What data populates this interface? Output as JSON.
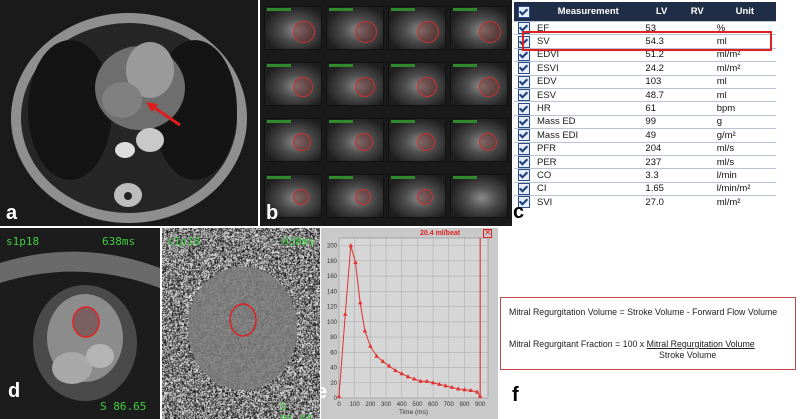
{
  "panel_labels": {
    "a": "a",
    "b": "b",
    "c": "c",
    "d": "d",
    "e": "e",
    "f": "f"
  },
  "table": {
    "headers": [
      "Measurement",
      "LV",
      "RV",
      "Unit"
    ],
    "highlight_row": "SV",
    "rows": [
      {
        "name": "EF",
        "lv": "53",
        "rv": "",
        "unit": "%"
      },
      {
        "name": "SV",
        "lv": "54.3",
        "rv": "",
        "unit": "ml"
      },
      {
        "name": "EDVI",
        "lv": "51.2",
        "rv": "",
        "unit": "ml/m²"
      },
      {
        "name": "ESVI",
        "lv": "24.2",
        "rv": "",
        "unit": "ml/m²"
      },
      {
        "name": "EDV",
        "lv": "103",
        "rv": "",
        "unit": "ml"
      },
      {
        "name": "ESV",
        "lv": "48.7",
        "rv": "",
        "unit": "ml"
      },
      {
        "name": "HR",
        "lv": "61",
        "rv": "",
        "unit": "bpm"
      },
      {
        "name": "Mass ED",
        "lv": "99",
        "rv": "",
        "unit": "g"
      },
      {
        "name": "Mass EDI",
        "lv": "49",
        "rv": "",
        "unit": "g/m²"
      },
      {
        "name": "PFR",
        "lv": "204",
        "rv": "",
        "unit": "ml/s"
      },
      {
        "name": "PER",
        "lv": "237",
        "rv": "",
        "unit": "ml/s"
      },
      {
        "name": "CO",
        "lv": "3.3",
        "rv": "",
        "unit": "l/min"
      },
      {
        "name": "CI",
        "lv": "1.65",
        "rv": "",
        "unit": "l/min/m²"
      },
      {
        "name": "SVI",
        "lv": "27.0",
        "rv": "",
        "unit": "ml/m²"
      }
    ]
  },
  "overlay_d": {
    "slice": "s1p18",
    "time": "638ms",
    "bottom": "S 86.65"
  },
  "overlay_e_map": {
    "slice": "s1p18",
    "time": "638ms",
    "bottom": "S 86.65"
  },
  "flow_chart_header": "20.4 ml/beat",
  "formula": {
    "line1": "Mitral Regurgitation Volume = Stroke Volume - Forward Flow Volume",
    "line2_prefix": "Mitral Regurgitant Fraction = 100 x ",
    "line2_numerator": "Mitral Regurgitation Volume",
    "line3_denominator": "Stroke Volume"
  },
  "chart_data": {
    "type": "line",
    "xlabel": "Time (ms)",
    "ylabel": "",
    "xlim": [
      0,
      950
    ],
    "ylim": [
      0,
      210
    ],
    "x_ticks": [
      0,
      100,
      200,
      300,
      400,
      500,
      600,
      700,
      800,
      900
    ],
    "y_ticks": [
      0,
      20,
      40,
      60,
      80,
      100,
      120,
      140,
      160,
      180,
      200
    ],
    "grid": true,
    "series": [
      {
        "color": "#e03030",
        "x": [
          0,
          40,
          75,
          105,
          135,
          165,
          200,
          240,
          280,
          320,
          360,
          400,
          440,
          480,
          520,
          560,
          600,
          640,
          680,
          720,
          760,
          800,
          840,
          880,
          900
        ],
        "y": [
          2,
          110,
          200,
          178,
          125,
          88,
          68,
          55,
          48,
          42,
          36,
          32,
          28,
          25,
          22,
          22,
          20,
          18,
          16,
          14,
          12,
          11,
          10,
          8,
          2
        ]
      }
    ]
  }
}
